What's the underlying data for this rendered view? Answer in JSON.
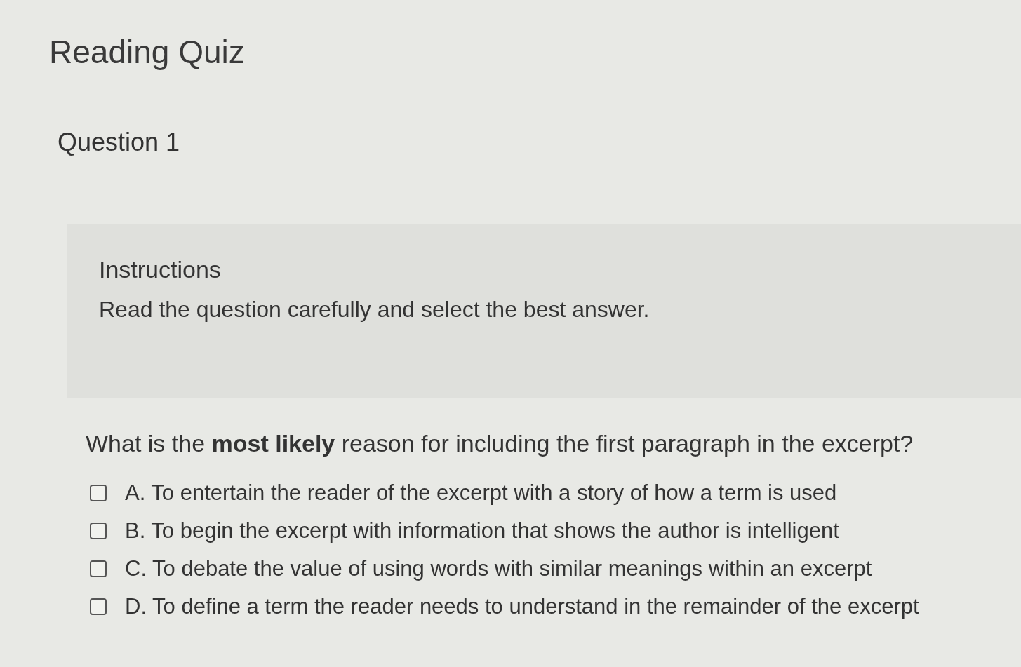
{
  "page": {
    "title": "Reading Quiz"
  },
  "question": {
    "heading": "Question 1",
    "instructions": {
      "heading": "Instructions",
      "text": "Read the question carefully and select the best answer."
    },
    "prompt": "What is the **most likely** reason for including the first paragraph in the excerpt?",
    "options": [
      {
        "label": "A. To entertain the reader of the excerpt with a story of how a term is used",
        "checked": false
      },
      {
        "label": "B. To begin the excerpt with information that shows the author is intelligent",
        "checked": false
      },
      {
        "label": "C. To debate the value of using words with similar meanings within an excerpt",
        "checked": false
      },
      {
        "label": "D. To define a term the reader needs to understand in the remainder of the excerpt",
        "checked": false
      }
    ]
  }
}
